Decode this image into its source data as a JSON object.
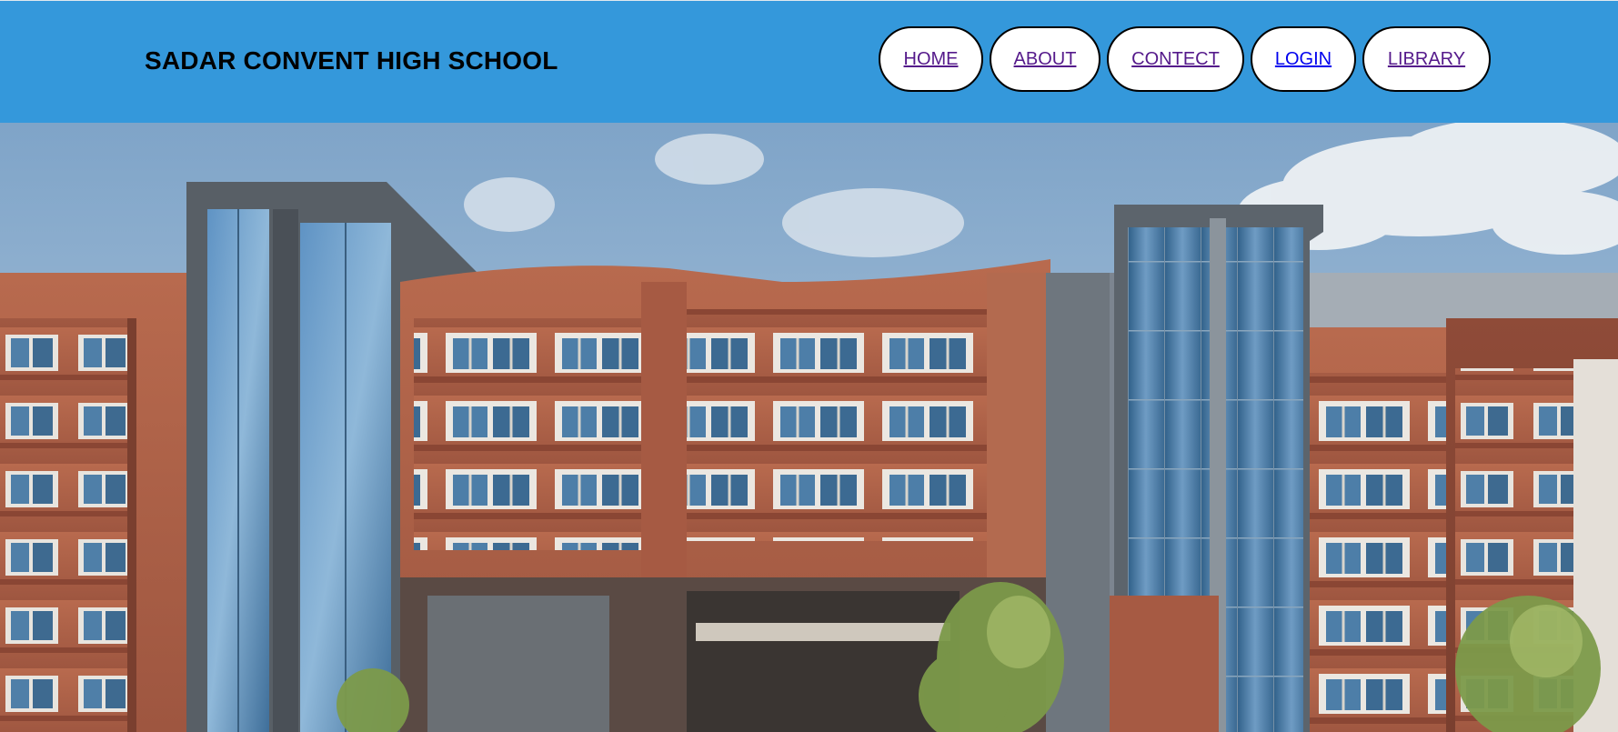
{
  "header": {
    "title": "SADAR CONVENT HIGH SCHOOL",
    "background_color": "#3498db"
  },
  "nav": {
    "items": [
      {
        "label": "HOME",
        "visited": true
      },
      {
        "label": "ABOUT",
        "visited": true
      },
      {
        "label": "CONTECT",
        "visited": true
      },
      {
        "label": "LOGIN",
        "visited": false
      },
      {
        "label": "LIBRARY",
        "visited": true
      }
    ]
  },
  "hero": {
    "subject": "school-building-photo"
  }
}
